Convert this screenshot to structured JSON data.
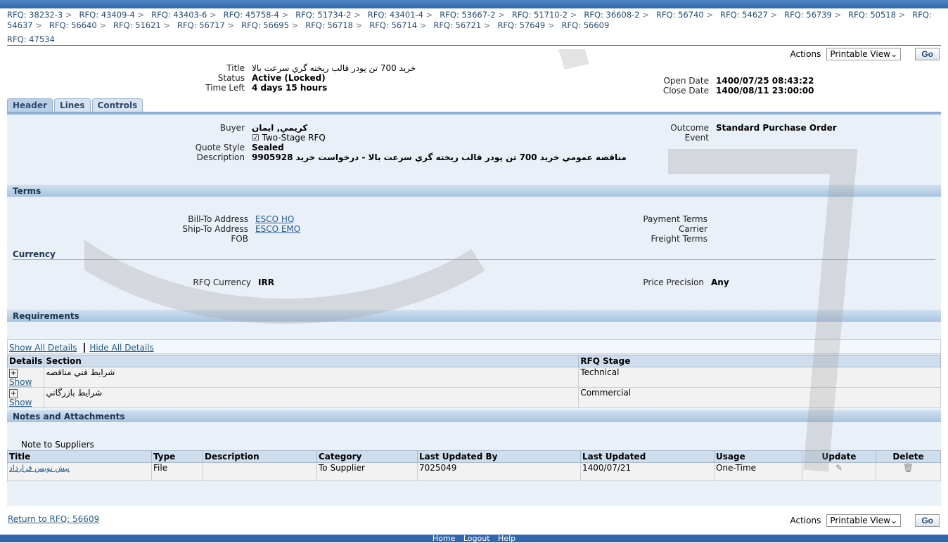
{
  "breadcrumbs": [
    "RFQ: 38232-3",
    "RFQ: 43409-4",
    "RFQ: 43403-6",
    "RFQ: 45758-4",
    "RFQ: 51734-2",
    "RFQ: 43401-4",
    "RFQ: 53667-2",
    "RFQ: 51710-2",
    "RFQ: 36608-2",
    "RFQ: 56740",
    "RFQ: 54627",
    "RFQ: 56739",
    "RFQ: 50518",
    "RFQ: 54637",
    "RFQ: 56640",
    "RFQ: 51621",
    "RFQ: 56717",
    "RFQ: 56695",
    "RFQ: 56718",
    "RFQ: 56714",
    "RFQ: 56721",
    "RFQ: 57649",
    "RFQ: 56609"
  ],
  "page_title": "RFQ: 47534",
  "actions": {
    "label": "Actions",
    "selected": "Printable View",
    "go": "Go"
  },
  "summary": {
    "title_label": "Title",
    "title": "خريد 700 تن پودر قالب ريخته گري سرعت بالا",
    "status_label": "Status",
    "status": "Active (Locked)",
    "time_left_label": "Time Left",
    "time_left": "4 days 15 hours",
    "open_label": "Open Date",
    "open": "1400/07/25 08:43:22",
    "close_label": "Close Date",
    "close": "1400/08/11 23:00:00"
  },
  "tabs": [
    "Header",
    "Lines",
    "Controls"
  ],
  "header": {
    "buyer_label": "Buyer",
    "buyer": "كريمي, ايمان",
    "two_stage": "Two-Stage RFQ",
    "two_stage_checked": true,
    "quote_style_label": "Quote Style",
    "quote_style": "Sealed",
    "description_label": "Description",
    "description": "مناقصه عمومي خريد 700 تن پودر قالب ريخته گري سرعت بالا - درخواست خريد 9905928",
    "outcome_label": "Outcome",
    "outcome": "Standard Purchase Order",
    "event_label": "Event"
  },
  "terms": {
    "title": "Terms",
    "bill_to_label": "Bill-To Address",
    "bill_to": "ESCO HQ",
    "ship_to_label": "Ship-To Address",
    "ship_to": "ESCO EMO",
    "fob_label": "FOB",
    "payment_label": "Payment Terms",
    "carrier_label": "Carrier",
    "freight_label": "Freight Terms",
    "currency_title": "Currency",
    "rfq_currency_label": "RFQ Currency",
    "rfq_currency": "IRR",
    "price_precision_label": "Price Precision",
    "price_precision": "Any"
  },
  "requirements": {
    "title": "Requirements",
    "show_all": "Show All Details",
    "hide_all": "Hide All Details",
    "columns": [
      "Details",
      "Section",
      "RFQ Stage"
    ],
    "rows": [
      {
        "show": "Show",
        "section": "شرايط فني مناقصه",
        "stage": "Technical"
      },
      {
        "show": "Show",
        "section": "شرايط بازرگاني",
        "stage": "Commercial"
      }
    ]
  },
  "notes": {
    "title": "Notes and Attachments",
    "note_label": "Note to Suppliers",
    "columns": [
      "Title",
      "Type",
      "Description",
      "Category",
      "Last Updated By",
      "Last Updated",
      "Usage",
      "Update",
      "Delete"
    ],
    "rows": [
      {
        "title": "پیش نویس قرارداد",
        "type": "File",
        "description": "",
        "category": "To Supplier",
        "updated_by": "7025049",
        "updated": "1400/07/21",
        "usage": "One-Time"
      }
    ]
  },
  "return_link": "Return to RFQ: 56609",
  "footer": [
    "Home",
    "Logout",
    "Help"
  ]
}
